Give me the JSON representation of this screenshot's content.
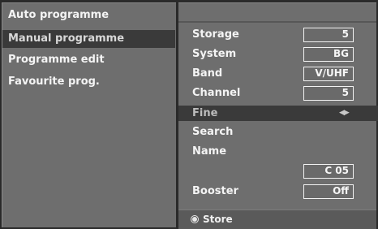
{
  "menu": {
    "items": [
      {
        "label": "Auto programme",
        "selected": false
      },
      {
        "label": "Manual programme",
        "selected": true
      },
      {
        "label": "Programme edit",
        "selected": false
      },
      {
        "label": "Favourite prog.",
        "selected": false
      }
    ]
  },
  "settings": {
    "storage": {
      "label": "Storage",
      "value": "5"
    },
    "system": {
      "label": "System",
      "value": "BG"
    },
    "band": {
      "label": "Band",
      "value": "V/UHF"
    },
    "channel": {
      "label": "Channel",
      "value": "5"
    },
    "fine": {
      "label": "Fine",
      "arrows": "◀▶"
    },
    "search": {
      "label": "Search"
    },
    "name": {
      "label": "Name",
      "value": "C 05"
    },
    "booster": {
      "label": "Booster",
      "value": "Off"
    }
  },
  "footer": {
    "store_label": "Store",
    "store_icon": "circle-button-icon"
  }
}
